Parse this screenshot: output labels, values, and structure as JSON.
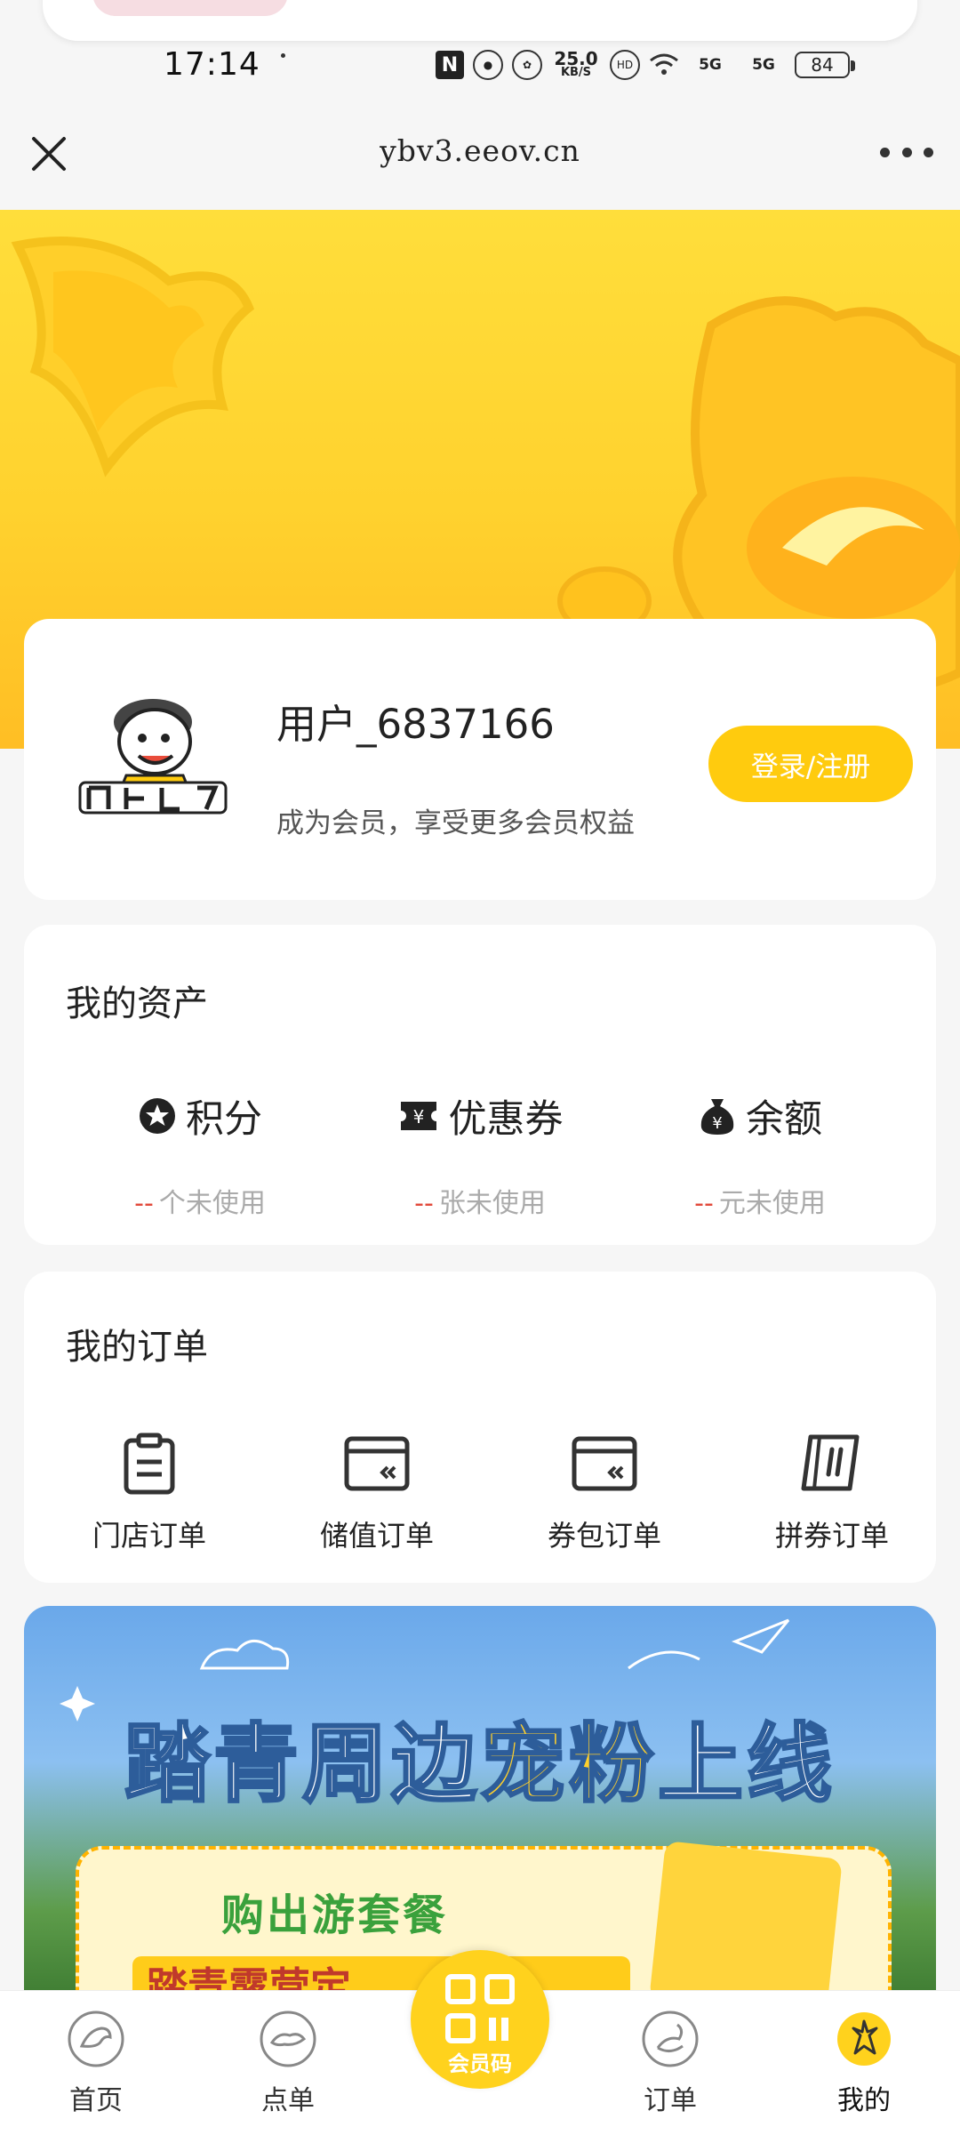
{
  "status_bar": {
    "time": "17:14",
    "speed_value": "25.0",
    "speed_unit": "KB/S",
    "network_1": "5G",
    "network_2": "5G",
    "battery": "84"
  },
  "browser": {
    "url": "ybv3.eeov.cn"
  },
  "colors": {
    "brand_yellow": "#ffcb0e",
    "banner_yellow": "#ffd22e",
    "accent_red": "#e24a3b"
  },
  "profile": {
    "username": "用户_6837166",
    "member_tip": "成为会员，享受更多会员权益",
    "login_button": "登录/注册",
    "avatar_icon": "zhou-hei-ya-logo"
  },
  "assets": {
    "title": "我的资产",
    "items": [
      {
        "icon": "star-badge-icon",
        "label": "积分",
        "value": "--",
        "suffix": "个未使用"
      },
      {
        "icon": "coupon-icon",
        "label": "优惠券",
        "value": "--",
        "suffix": "张未使用"
      },
      {
        "icon": "money-bag-icon",
        "label": "余额",
        "value": "--",
        "suffix": "元未使用"
      }
    ]
  },
  "orders": {
    "title": "我的订单",
    "items": [
      {
        "icon": "clipboard-icon",
        "label": "门店订单"
      },
      {
        "icon": "card-icon",
        "label": "储值订单"
      },
      {
        "icon": "wallet-icon",
        "label": "券包订单"
      },
      {
        "icon": "ticket-icon",
        "label": "拼券订单"
      }
    ]
  },
  "promo": {
    "title_a": "踏青周边",
    "title_highlight": "宠粉",
    "title_b": "上线",
    "subtitle": "购出游套餐",
    "strip_text": "踏青露营定"
  },
  "tabbar": {
    "items": [
      {
        "icon": "home-icon",
        "label": "首页"
      },
      {
        "icon": "order-food-icon",
        "label": "点单"
      },
      {
        "icon": "orders-icon",
        "label": "订单"
      },
      {
        "icon": "mine-icon",
        "label": "我的"
      }
    ],
    "center_label": "会员码"
  }
}
